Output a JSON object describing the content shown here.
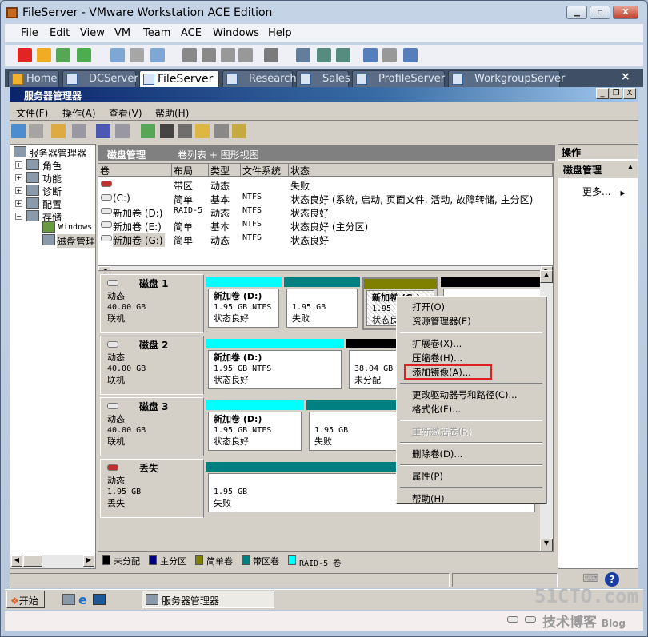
{
  "window": {
    "title": "FileServer - VMware Workstation ACE Edition"
  },
  "menu": [
    "File",
    "Edit",
    "View",
    "VM",
    "Team",
    "ACE",
    "Windows",
    "Help"
  ],
  "tabs": [
    "Home",
    "DCServer",
    "FileServer",
    "Research",
    "Sales",
    "ProfileServer",
    "WorkgroupServer"
  ],
  "tab_close": "×",
  "mmc": {
    "title": "服务器管理器",
    "menu": [
      "文件(F)",
      "操作(A)",
      "查看(V)",
      "帮助(H)"
    ]
  },
  "tree": {
    "root": "服务器管理器",
    "items": [
      "角色",
      "功能",
      "诊断",
      "配置",
      "存储"
    ],
    "storage_children": [
      "Windows",
      "磁盘管理"
    ]
  },
  "center": {
    "title": "磁盘管理",
    "view": "卷列表 + 图形视图",
    "columns": [
      "卷",
      "布局",
      "类型",
      "文件系统",
      "状态"
    ],
    "rows": [
      [
        "",
        "带区",
        "动态",
        "",
        "失败"
      ],
      [
        "(C:)",
        "简单",
        "基本",
        "NTFS",
        "状态良好 (系统, 启动, 页面文件, 活动, 故障转储, 主分区)"
      ],
      [
        "新加卷 (D:)",
        "RAID-5",
        "动态",
        "NTFS",
        "状态良好"
      ],
      [
        "新加卷 (E:)",
        "简单",
        "基本",
        "NTFS",
        "状态良好 (主分区)"
      ],
      [
        "新加卷 (G:)",
        "简单",
        "动态",
        "NTFS",
        "状态良好"
      ]
    ]
  },
  "disks": [
    {
      "name": "磁盘 1",
      "type": "动态",
      "size": "40.00 GB",
      "state": "联机",
      "parts": [
        {
          "label": "新加卷 (D:)",
          "size": "1.95 GB NTFS",
          "status": "状态良好",
          "color": "#00ffff"
        },
        {
          "label": "",
          "size": "1.95 GB",
          "status": "失败",
          "color": "#008080"
        },
        {
          "label": "新加卷 (G:)",
          "size": "1.95 GB",
          "status": "状态良好",
          "color": "#808000"
        },
        {
          "label": "",
          "size": "",
          "status": "",
          "color": "#000000"
        }
      ]
    },
    {
      "name": "磁盘 2",
      "type": "动态",
      "size": "40.00 GB",
      "state": "联机",
      "parts": [
        {
          "label": "新加卷 (D:)",
          "size": "1.95 GB NTFS",
          "status": "状态良好",
          "color": "#00ffff"
        },
        {
          "label": "",
          "size": "38.04 GB",
          "status": "未分配",
          "color": "#000000"
        }
      ]
    },
    {
      "name": "磁盘 3",
      "type": "动态",
      "size": "40.00 GB",
      "state": "联机",
      "parts": [
        {
          "label": "新加卷 (D:)",
          "size": "1.95 GB NTFS",
          "status": "状态良好",
          "color": "#00ffff"
        },
        {
          "label": "",
          "size": "1.95 GB",
          "status": "失败",
          "color": "#008080"
        }
      ]
    },
    {
      "name": "丢失",
      "type": "动态",
      "size": "1.95 GB",
      "state": "丢失",
      "parts": [
        {
          "label": "",
          "size": "1.95 GB",
          "status": "失败",
          "color": "#008080"
        }
      ]
    }
  ],
  "legend": [
    {
      "label": "未分配",
      "color": "#000000"
    },
    {
      "label": "主分区",
      "color": "#000080"
    },
    {
      "label": "简单卷",
      "color": "#808000"
    },
    {
      "label": "带区卷",
      "color": "#008080"
    },
    {
      "label": "RAID-5 卷",
      "color": "#00ffff"
    }
  ],
  "actions": {
    "title": "操作",
    "section": "磁盘管理",
    "more": "更多..."
  },
  "context_menu": [
    {
      "label": "打开(O)"
    },
    {
      "label": "资源管理器(E)"
    },
    {
      "sep": true
    },
    {
      "label": "扩展卷(X)..."
    },
    {
      "label": "压缩卷(H)..."
    },
    {
      "label": "添加镜像(A)...",
      "highlight": true
    },
    {
      "sep": true
    },
    {
      "label": "更改驱动器号和路径(C)..."
    },
    {
      "label": "格式化(F)..."
    },
    {
      "sep": true
    },
    {
      "label": "重新激活卷(R)",
      "disabled": true
    },
    {
      "sep": true
    },
    {
      "label": "删除卷(D)..."
    },
    {
      "sep": true
    },
    {
      "label": "属性(P)"
    },
    {
      "sep": true
    },
    {
      "label": "帮助(H)"
    }
  ],
  "taskbar": {
    "start": "开始",
    "task": "服务器管理器"
  },
  "watermark": "51CTO.com 技术博客 Blog"
}
